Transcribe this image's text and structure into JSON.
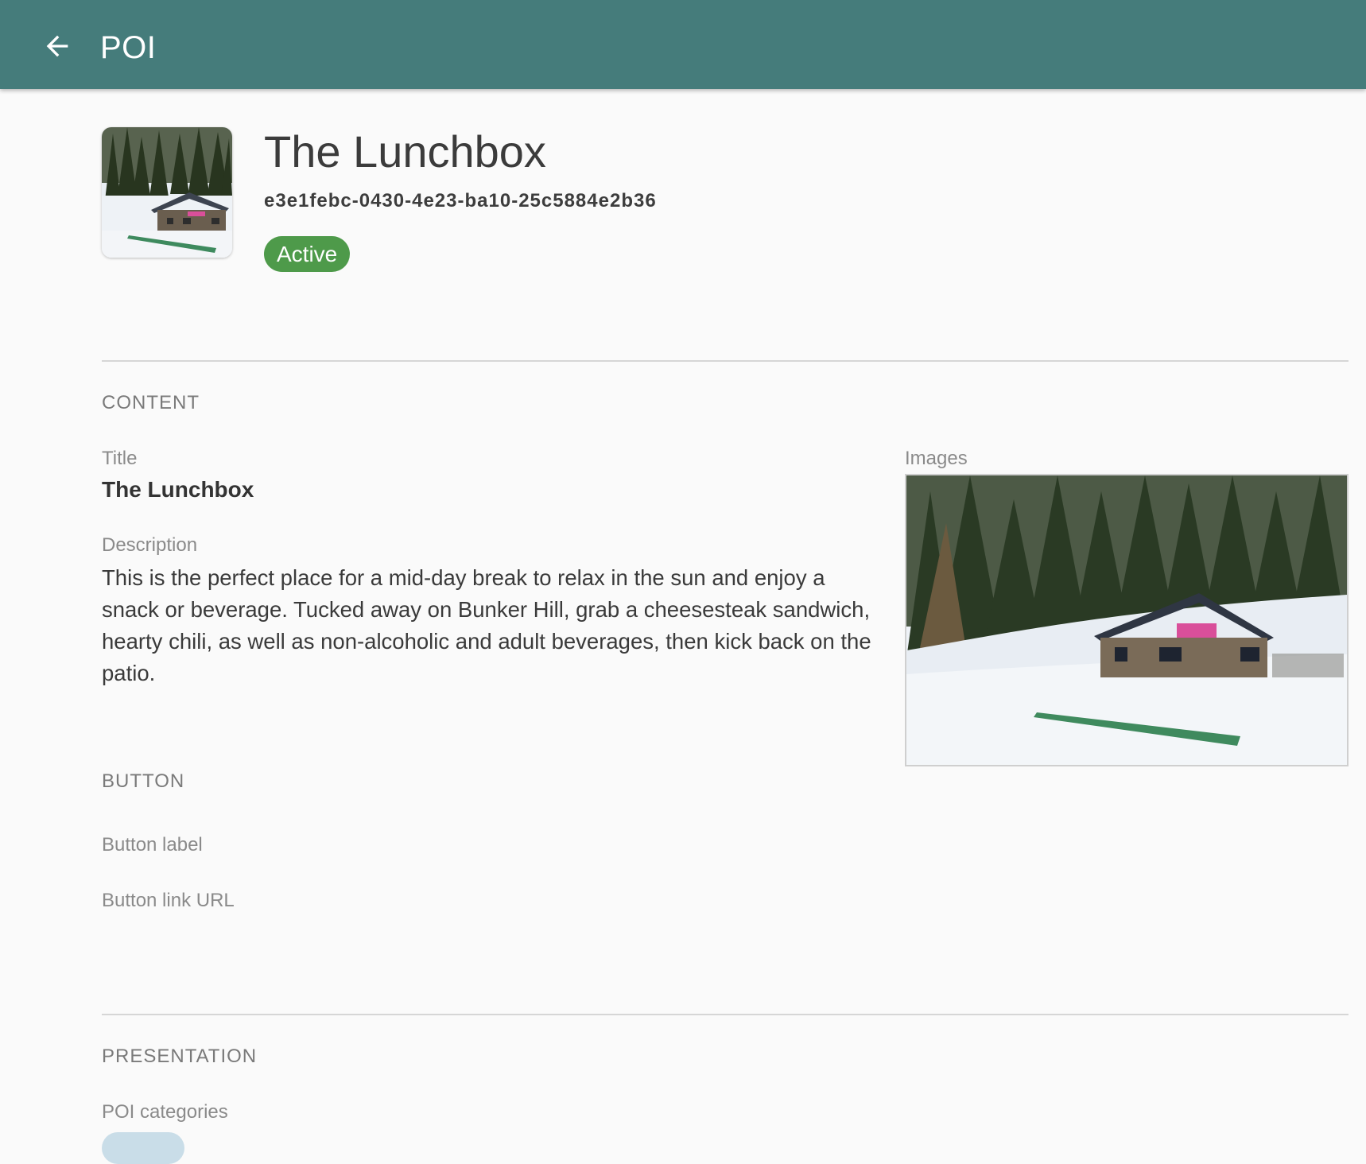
{
  "appbar": {
    "title": "POI",
    "background": "#457c7b",
    "back_icon": "arrow-back-icon"
  },
  "header": {
    "name": "The Lunchbox",
    "id": "e3e1febc-0430-4e23-ba10-25c5884e2b36",
    "status": "Active",
    "status_color": "#4e9a4a"
  },
  "content": {
    "heading": "CONTENT",
    "title_label": "Title",
    "title_value": "The Lunchbox",
    "description_label": "Description",
    "description_value": "This is the perfect place for a mid-day break to relax in the sun and enjoy a snack or beverage. Tucked away on Bunker Hill, grab a cheesesteak sand­wich, hearty chili, as well as non-alcoholic and adult beverages, then kick back on the patio.",
    "images_label": "Images"
  },
  "button": {
    "heading": "BUTTON",
    "label_label": "Button label",
    "link_label": "Button link URL"
  },
  "presentation": {
    "heading": "PRESENTATION",
    "categories_label": "POI categories"
  }
}
